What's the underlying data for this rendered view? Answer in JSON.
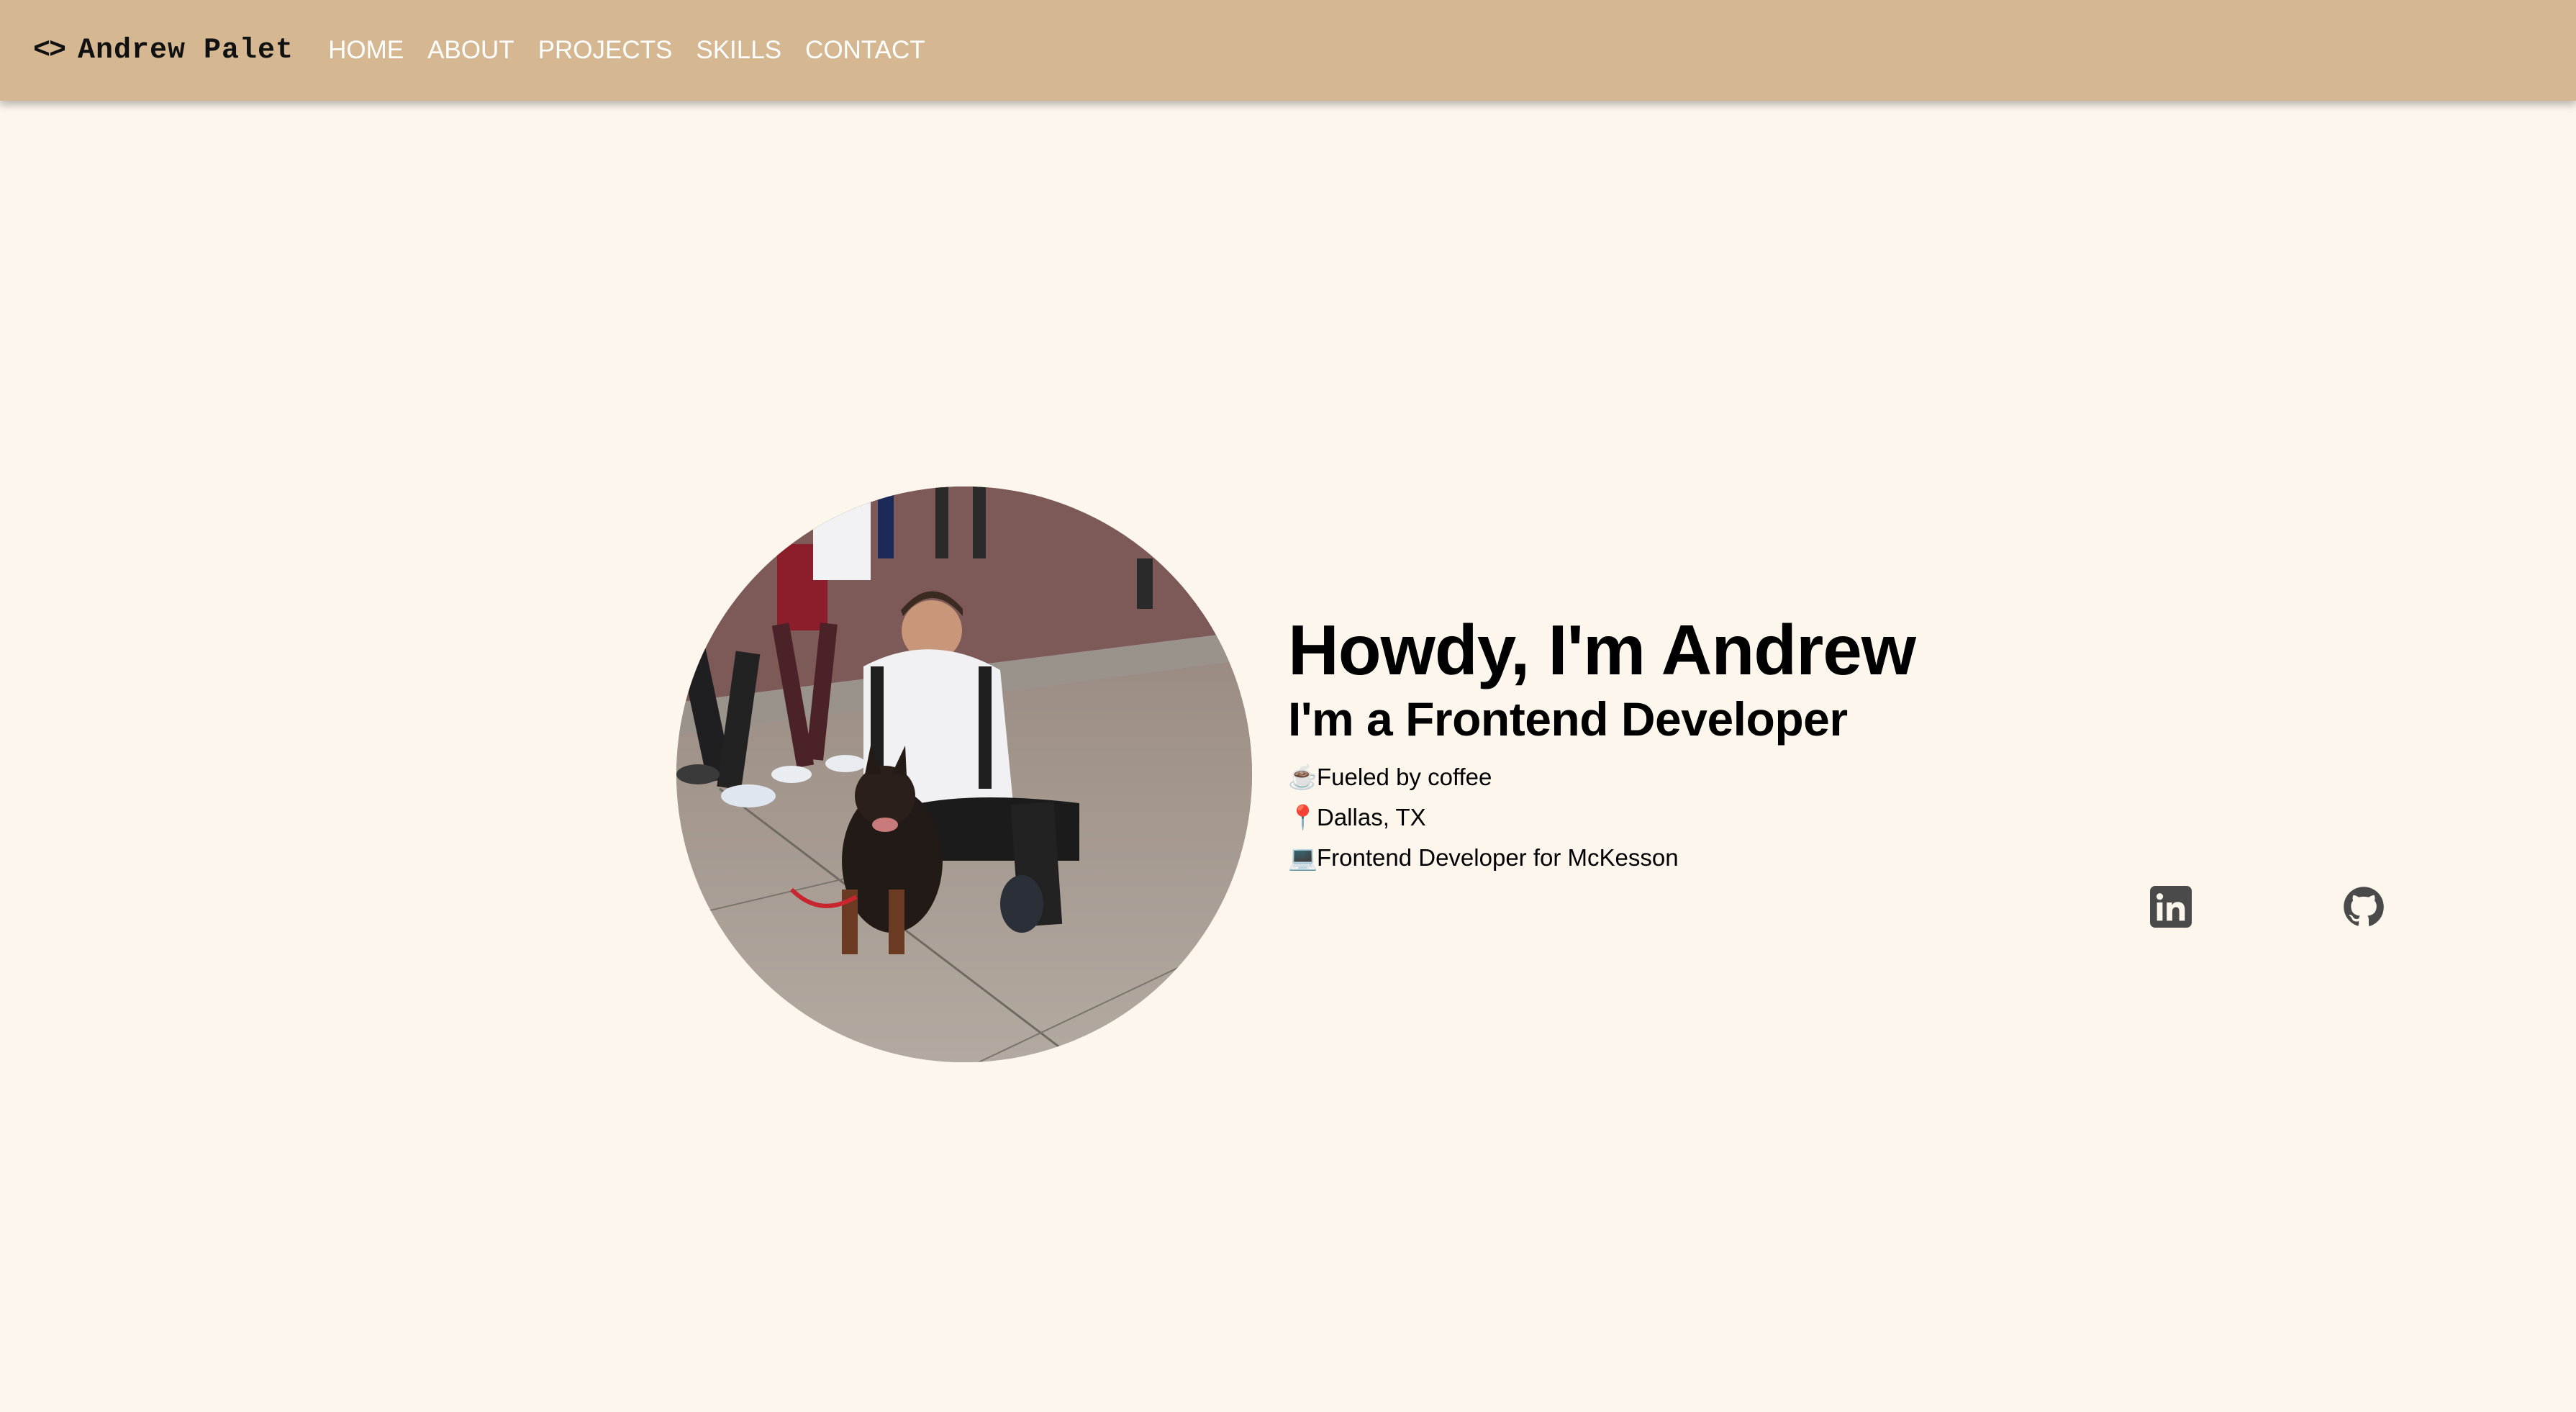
{
  "nav": {
    "brand_icon": "<>",
    "brand_name": "Andrew Palet",
    "links": [
      {
        "label": "HOME"
      },
      {
        "label": "ABOUT"
      },
      {
        "label": "PROJECTS"
      },
      {
        "label": "SKILLS"
      },
      {
        "label": "CONTACT"
      }
    ]
  },
  "hero": {
    "photo_icon": "profile-photo",
    "greeting": "Howdy, I'm Andrew",
    "role": "I'm a Frontend Developer",
    "facts": [
      {
        "emoji": "☕",
        "text": "Fueled by coffee"
      },
      {
        "emoji": "📍",
        "text": "Dallas, TX"
      },
      {
        "emoji": "💻",
        "text": "Frontend Developer for McKesson"
      }
    ],
    "socials": [
      {
        "icon": "linkedin-icon"
      },
      {
        "icon": "github-icon"
      }
    ]
  },
  "colors": {
    "navbar": "#d5b892",
    "background": "#fcf6ec",
    "nav_text": "#ffffff",
    "social_icon": "#4a4a4a"
  }
}
